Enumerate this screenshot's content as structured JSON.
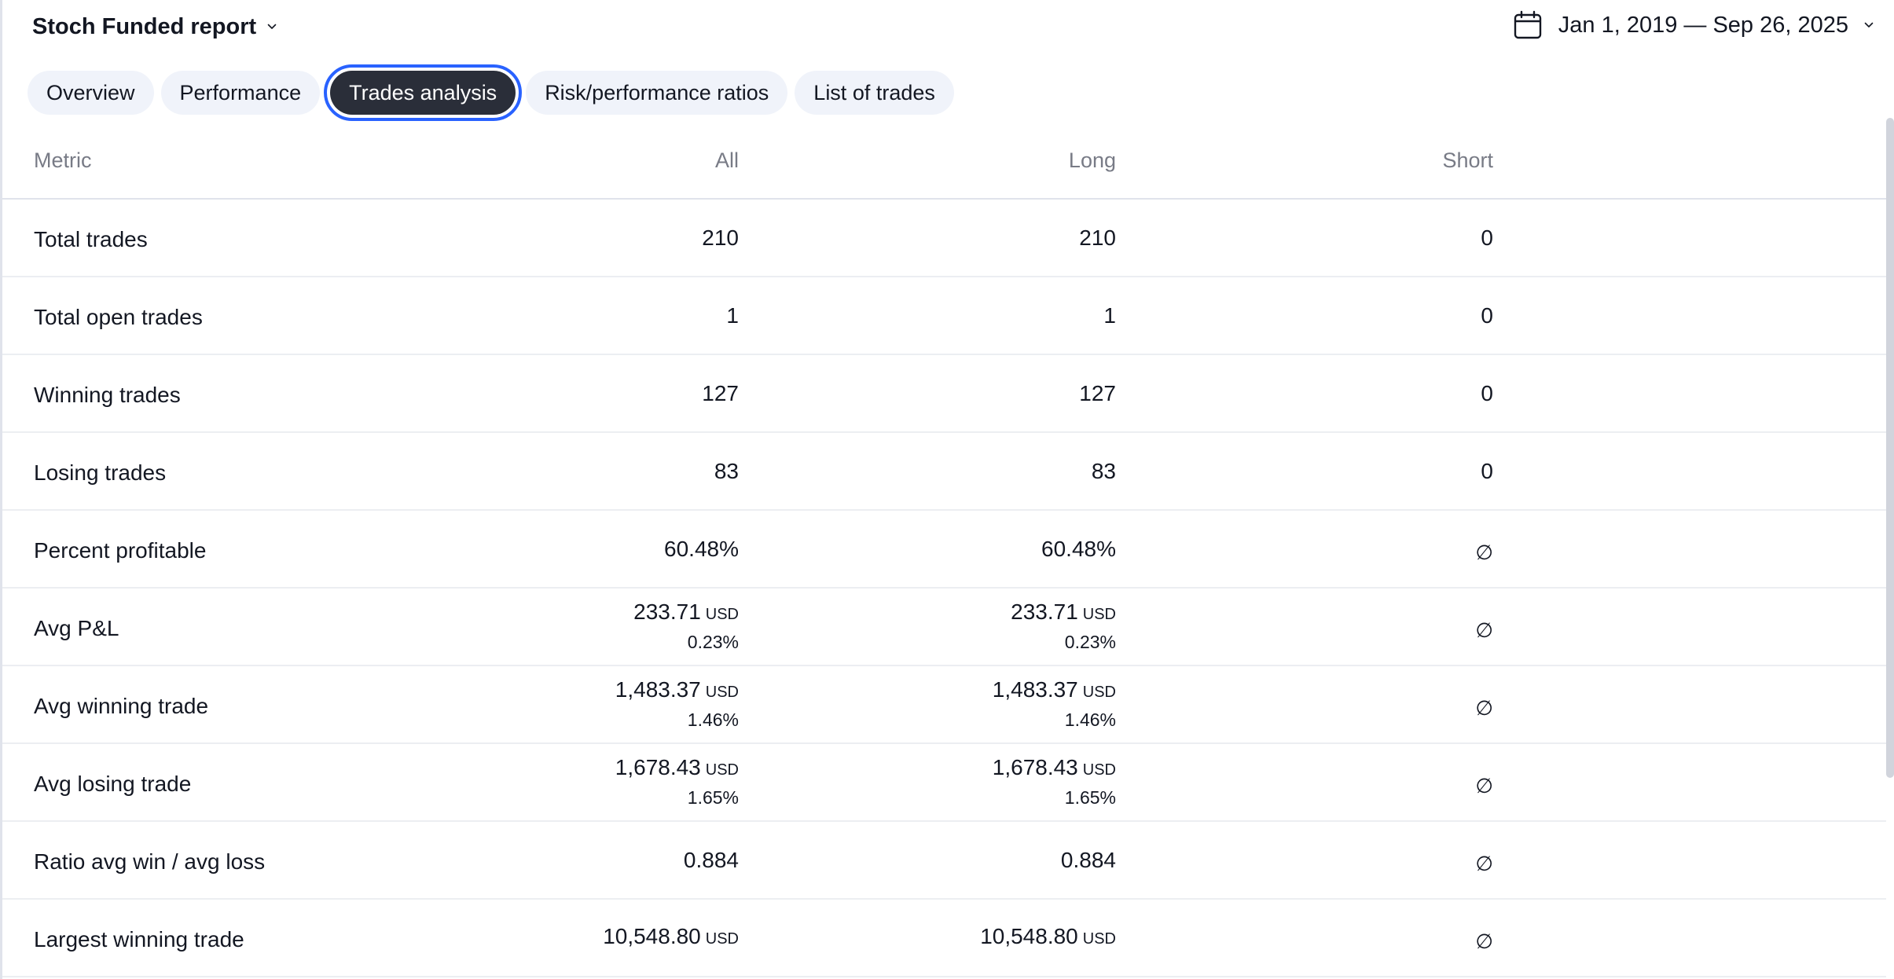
{
  "header": {
    "report_title": "Stoch Funded report",
    "date_range": "Jan 1, 2019 — Sep 26, 2025"
  },
  "tabs": [
    {
      "label": "Overview",
      "active": false
    },
    {
      "label": "Performance",
      "active": false
    },
    {
      "label": "Trades analysis",
      "active": true
    },
    {
      "label": "Risk/performance ratios",
      "active": false
    },
    {
      "label": "List of trades",
      "active": false
    }
  ],
  "table": {
    "headers": {
      "metric": "Metric",
      "all": "All",
      "long": "Long",
      "short": "Short"
    },
    "rows": [
      {
        "metric": "Total trades",
        "all": {
          "value": "210",
          "unit": "",
          "sub": ""
        },
        "long": {
          "value": "210",
          "unit": "",
          "sub": ""
        },
        "short": {
          "value": "0",
          "unit": "",
          "sub": ""
        }
      },
      {
        "metric": "Total open trades",
        "all": {
          "value": "1",
          "unit": "",
          "sub": ""
        },
        "long": {
          "value": "1",
          "unit": "",
          "sub": ""
        },
        "short": {
          "value": "0",
          "unit": "",
          "sub": ""
        }
      },
      {
        "metric": "Winning trades",
        "all": {
          "value": "127",
          "unit": "",
          "sub": ""
        },
        "long": {
          "value": "127",
          "unit": "",
          "sub": ""
        },
        "short": {
          "value": "0",
          "unit": "",
          "sub": ""
        }
      },
      {
        "metric": "Losing trades",
        "all": {
          "value": "83",
          "unit": "",
          "sub": ""
        },
        "long": {
          "value": "83",
          "unit": "",
          "sub": ""
        },
        "short": {
          "value": "0",
          "unit": "",
          "sub": ""
        }
      },
      {
        "metric": "Percent profitable",
        "all": {
          "value": "60.48%",
          "unit": "",
          "sub": ""
        },
        "long": {
          "value": "60.48%",
          "unit": "",
          "sub": ""
        },
        "short": {
          "value": "∅",
          "unit": "",
          "sub": ""
        }
      },
      {
        "metric": "Avg P&L",
        "all": {
          "value": "233.71",
          "unit": "USD",
          "sub": "0.23%"
        },
        "long": {
          "value": "233.71",
          "unit": "USD",
          "sub": "0.23%"
        },
        "short": {
          "value": "∅",
          "unit": "",
          "sub": ""
        }
      },
      {
        "metric": "Avg winning trade",
        "all": {
          "value": "1,483.37",
          "unit": "USD",
          "sub": "1.46%"
        },
        "long": {
          "value": "1,483.37",
          "unit": "USD",
          "sub": "1.46%"
        },
        "short": {
          "value": "∅",
          "unit": "",
          "sub": ""
        }
      },
      {
        "metric": "Avg losing trade",
        "all": {
          "value": "1,678.43",
          "unit": "USD",
          "sub": "1.65%"
        },
        "long": {
          "value": "1,678.43",
          "unit": "USD",
          "sub": "1.65%"
        },
        "short": {
          "value": "∅",
          "unit": "",
          "sub": ""
        }
      },
      {
        "metric": "Ratio avg win / avg loss",
        "all": {
          "value": "0.884",
          "unit": "",
          "sub": ""
        },
        "long": {
          "value": "0.884",
          "unit": "",
          "sub": ""
        },
        "short": {
          "value": "∅",
          "unit": "",
          "sub": ""
        }
      },
      {
        "metric": "Largest winning trade",
        "all": {
          "value": "10,548.80",
          "unit": "USD",
          "sub": ""
        },
        "long": {
          "value": "10,548.80",
          "unit": "USD",
          "sub": ""
        },
        "short": {
          "value": "∅",
          "unit": "",
          "sub": ""
        }
      }
    ]
  },
  "icons": {
    "title_dropdown": "chevron-down-icon",
    "date_picker": "calendar-icon",
    "date_dropdown": "chevron-down-icon"
  },
  "colors": {
    "active_tab_bg": "#2a2e39",
    "active_tab_outline": "#2962ff",
    "tab_bg": "#f0f3fa",
    "header_text": "#787b86"
  }
}
